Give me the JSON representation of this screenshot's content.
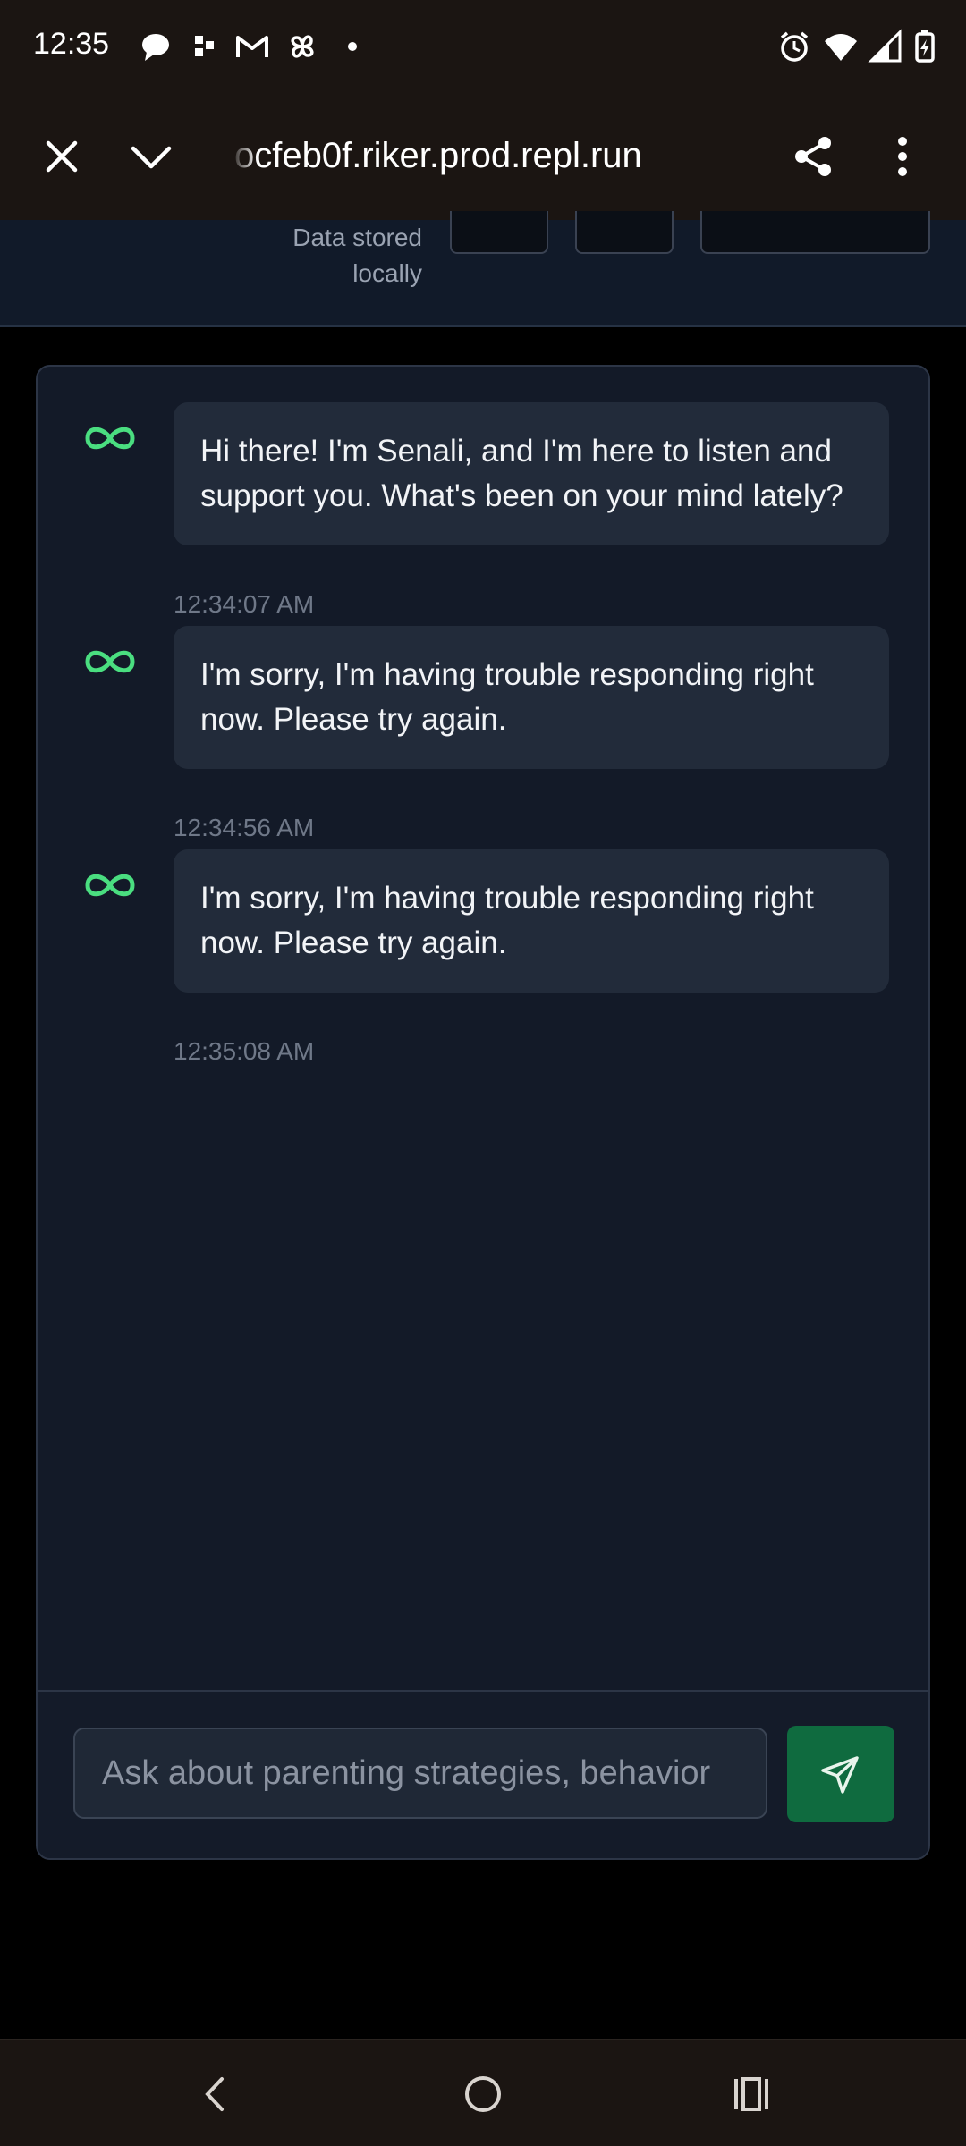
{
  "status_bar": {
    "time": "12:35",
    "left_icons": [
      "chat-bubble-icon",
      "dots-grid-icon",
      "gmail-icon",
      "pinwheel-icon",
      "dot-icon"
    ],
    "right_icons": [
      "alarm-icon",
      "wifi-icon",
      "signal-icon",
      "battery-icon"
    ]
  },
  "browser": {
    "url": "ocfeb0f.riker.prod.repl.run",
    "close_icon": "close-icon",
    "expand_icon": "chevron-down-icon",
    "share_icon": "share-icon",
    "menu_icon": "more-vert-icon"
  },
  "header": {
    "storage_note_line1": "Data stored",
    "storage_note_line2": "locally"
  },
  "chat": {
    "messages": [
      {
        "sender": "assistant",
        "avatar_icon": "infinity-icon",
        "text": "Hi there! I'm Senali, and I'm here to listen and support you. What's been on your mind lately?",
        "time": "12:34:07 AM"
      },
      {
        "sender": "assistant",
        "avatar_icon": "infinity-icon",
        "text": "I'm sorry, I'm having trouble responding right now. Please try again.",
        "time": "12:34:56 AM"
      },
      {
        "sender": "assistant",
        "avatar_icon": "infinity-icon",
        "text": "I'm sorry, I'm having trouble responding right now. Please try again.",
        "time": "12:35:08 AM"
      }
    ],
    "input": {
      "placeholder": "Ask about parenting strategies, behavior",
      "value": ""
    },
    "send_icon": "send-icon"
  },
  "nav": {
    "back_icon": "back-icon",
    "home_icon": "home-icon",
    "recents_icon": "recents-icon"
  },
  "colors": {
    "accent": "#0f6b3f",
    "infinity": "#4ade80",
    "panel": "#131a28",
    "bubble": "#222b3a"
  }
}
